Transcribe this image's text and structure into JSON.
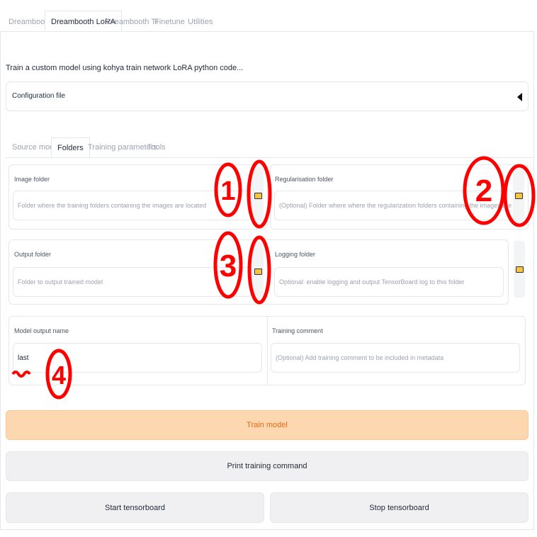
{
  "top_tabs": [
    "Dreambooth",
    "Dreambooth LoRA",
    "Dreambooth TI",
    "Finetune",
    "Utilities"
  ],
  "description": "Train a custom model using kohya train network LoRA python code...",
  "config": {
    "label": "Configuration file"
  },
  "sub_tabs": [
    "Source model",
    "Folders",
    "Training parameters",
    "Tools"
  ],
  "fields": {
    "image_folder": {
      "label": "Image folder",
      "placeholder": "Folder where the training folders containing the images are located"
    },
    "reg_folder": {
      "label": "Regularisation folder",
      "placeholder": "(Optional) Folder where where the regularization folders containing the images are located"
    },
    "output_folder": {
      "label": "Output folder",
      "placeholder": "Folder to output trained model"
    },
    "logging_folder": {
      "label": "Logging folder",
      "placeholder": "Optional: enable logging and output TensorBoard log to this folder"
    },
    "model_output_name": {
      "label": "Model output name",
      "value": "last"
    },
    "training_comment": {
      "label": "Training comment",
      "placeholder": "(Optional) Add training comment to be included in metadata"
    }
  },
  "buttons": {
    "train": "Train model",
    "print": "Print training command",
    "start_tb": "Start tensorboard",
    "stop_tb": "Stop tensorboard"
  },
  "annotations": [
    "1",
    "2",
    "3",
    "4"
  ],
  "colors": {
    "annotation": "#ff0000",
    "primary_button_bg": "#fcd7b0",
    "primary_button_text": "#ea6a12",
    "folder_icon": "#f5c542"
  }
}
